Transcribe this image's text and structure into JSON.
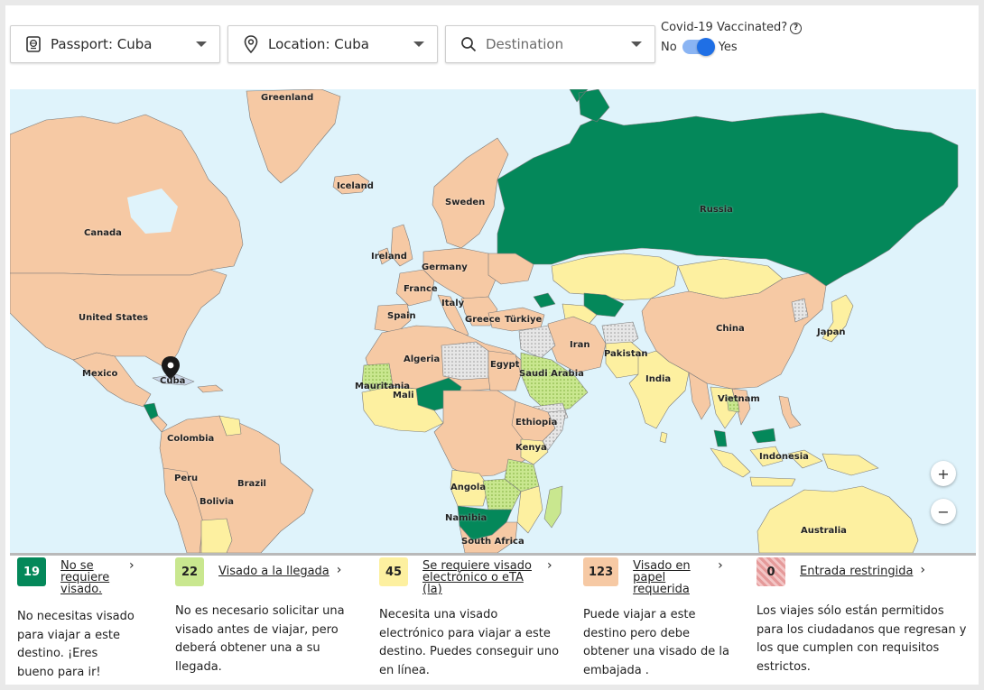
{
  "toolbar": {
    "passport": {
      "label": "Passport: Cuba",
      "icon": "passport-icon"
    },
    "location": {
      "label": "Location: Cuba",
      "icon": "location-pin-icon"
    },
    "destination": {
      "placeholder": "Destination",
      "icon": "search-icon"
    },
    "covid": {
      "label": "Covid-19 Vaccinated?",
      "no": "No",
      "yes": "Yes",
      "vaccinated": true
    }
  },
  "map": {
    "labels": {
      "greenland": "Greenland",
      "iceland": "Iceland",
      "canada": "Canada",
      "united_states": "United States",
      "mexico": "Mexico",
      "cuba": "Cuba",
      "colombia": "Colombia",
      "peru": "Peru",
      "brazil": "Brazil",
      "bolivia": "Bolivia",
      "sweden": "Sweden",
      "ireland": "Ireland",
      "germany": "Germany",
      "france": "France",
      "italy": "Italy",
      "spain": "Spain",
      "greece": "Greece",
      "turkiye": "Türkiye",
      "russia": "Russia",
      "china": "China",
      "japan": "Japan",
      "iran": "Iran",
      "pakistan": "Pakistan",
      "india": "India",
      "vietnam": "Vietnam",
      "indonesia": "Indonesia",
      "australia": "Australia",
      "algeria": "Algeria",
      "egypt": "Egypt",
      "saudi_arabia": "Saudi Arabia",
      "mauritania": "Mauritania",
      "mali": "Mali",
      "ethiopia": "Ethiopia",
      "kenya": "Kenya",
      "angola": "Angola",
      "namibia": "Namibia",
      "south_africa": "South Africa"
    },
    "zoom_in": "+",
    "zoom_out": "−",
    "colors": {
      "ocean": "#dff3fb",
      "visa_free": "#04885a",
      "on_arrival": "#c9e78f",
      "eta": "#fdf0a0",
      "embassy": "#f6c9a4",
      "restricted": "#dedede"
    }
  },
  "legend": [
    {
      "count": "19",
      "title": "No se requiere visado.",
      "desc": "No necesitas visado para viajar a este destino. ¡Eres bueno para ir!",
      "color": "#04885a",
      "text_color": "#ffffff"
    },
    {
      "count": "22",
      "title": "Visado a la llegada",
      "desc": "No es necesario solicitar una visado antes de viajar, pero deberá obtener una a su llegada.",
      "color": "#c9e78f",
      "text_color": "#222222"
    },
    {
      "count": "45",
      "title": "Se requiere visado electrónico o eTA (la)",
      "desc": "Necesita una visado electrónico para viajar a este destino. Puedes conseguir uno en línea.",
      "color": "#fdf0a0",
      "text_color": "#222222"
    },
    {
      "count": "123",
      "title": "Visado en papel requerida",
      "desc": "Puede viajar a este destino pero debe obtener una visado de la embajada .",
      "color": "#f6c9a4",
      "text_color": "#222222"
    },
    {
      "count": "0",
      "title": "Entrada restringida",
      "desc": "Los viajes sólo están permitidos para los ciudadanos que regresan y los que cumplen con requisitos estrictos.",
      "color": "#e59a9a",
      "text_color": "#222222"
    }
  ]
}
